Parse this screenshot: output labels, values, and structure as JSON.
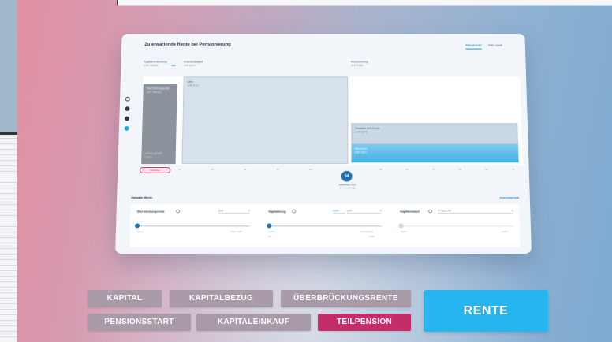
{
  "screen": {
    "title": "Zu erwartende Rente bei Pensionierung",
    "toggle_month": "PRO MONAT",
    "toggle_year": "PRO JAHR",
    "kapitalverwendung_label": "Kapitalverwendung",
    "kapitalverwendung_value": "CHF 208'022",
    "mix_badge": "MIX",
    "erwerb_label": "Erwerbstätigkeit",
    "erwerb_value": "CHF 8'127",
    "pension_label": "Pensionierung",
    "pension_value": "CHF 3'985",
    "bars": {
      "ueberbrueckung": "Überbrückungsrente",
      "ueberbrueckung_value": "CHF 208'022",
      "vorbezug": "Vorbezugsrente",
      "vorbezug_value": "CHF 0",
      "lohn": "Lohn",
      "lohn_value": "CHF 8'127",
      "erwartete_rente": "Erwartete AHV-Rente",
      "erwartete_rente_value": "CHF 2'378",
      "alters": "Altersrente",
      "alters_value": "CHF 1'607"
    },
    "axis_ticks": [
      "60",
      "61",
      "62",
      "63",
      "64",
      "65",
      "66",
      "67",
      "68",
      "69",
      "70"
    ],
    "pill_label": "Vorbezug",
    "age": "64",
    "age_date": "September 2023",
    "age_sub": "Pensionierung",
    "variable_title": "Variable Werte",
    "reset_label": "ZURÜCKSETZEN",
    "controls": [
      {
        "name": "Überbrückungsrente",
        "field_unit": "CHF",
        "field_value": "0",
        "min": "CHF 0",
        "max": "CHF 2'375",
        "level": 0.0
      },
      {
        "name": "Kapitalbezug",
        "percent": "0.0%",
        "field_unit": "CHF",
        "field_value": "0",
        "min": "CHF 0",
        "max": "CHF 208'022",
        "min_pct": "0%",
        "max_pct": "100%",
        "level": 0.0
      },
      {
        "name": "Kapitaleinkauf",
        "field_unit": "77'366 CHF",
        "field_value": "0",
        "min": "CHF 0",
        "max": "CHF 0",
        "level": 0.0
      }
    ]
  },
  "buttons": {
    "kapital": "KAPITAL",
    "kapitalbezug": "KAPITALBEZUG",
    "ueberbrueckungsrente": "ÜBERBRÜCKUNGSRENTE",
    "pensionsstart": "PENSIONSSTART",
    "kapitaleinkauf": "KAPITALEINKAUF",
    "teilpension": "TEILPENSION",
    "rente": "RENTE"
  },
  "colors": {
    "button_inactive": "#a99aa8",
    "button_active": "#c32e68",
    "primary_cta": "#25b5ef",
    "accent_blue": "#1a8fd6"
  }
}
